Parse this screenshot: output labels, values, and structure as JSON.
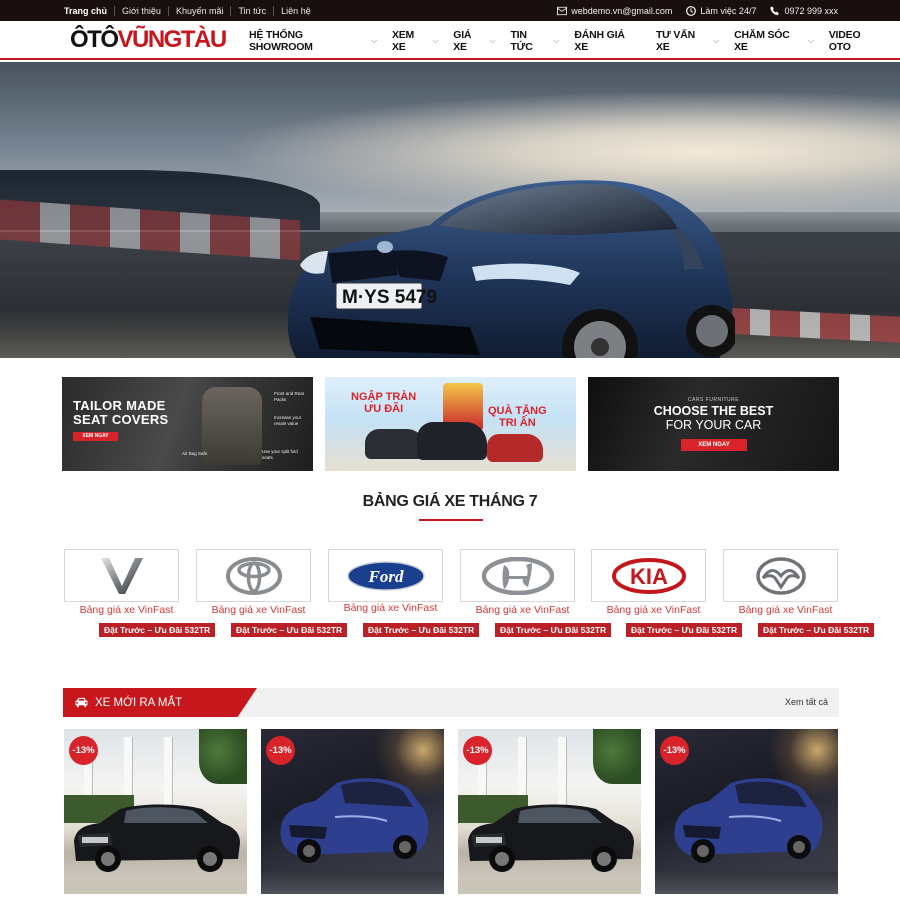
{
  "topbar": {
    "links": [
      "Trang chủ",
      "Giới thiệu",
      "Khuyến mãi",
      "Tin tức",
      "Liên hệ"
    ],
    "email": "webdemo.vn@gmail.com",
    "hours": "Làm việc 24/7",
    "phone": "0972 999 xxx"
  },
  "header": {
    "logo_part1": "ÔTÔ",
    "logo_part2": "VŨNGTÀU",
    "nav": [
      {
        "label": "HỆ THỐNG SHOWROOM",
        "dropdown": true
      },
      {
        "label": "XEM XE",
        "dropdown": true
      },
      {
        "label": "GIÁ XE",
        "dropdown": true
      },
      {
        "label": "TIN TỨC",
        "dropdown": true
      },
      {
        "label": "ĐÁNH GIÁ XE",
        "dropdown": false
      },
      {
        "label": "TƯ VẤN XE",
        "dropdown": true
      },
      {
        "label": "CHĂM SÓC XE",
        "dropdown": true
      },
      {
        "label": "VIDEO OTO",
        "dropdown": false
      }
    ]
  },
  "hero": {
    "plate": "M·YS 5479",
    "slides": 2,
    "active_slide": 1
  },
  "banners": {
    "b1": {
      "line1": "TAILOR MADE",
      "line2": "SEAT COVERS",
      "button": "XEM NGAY",
      "notes": [
        "Front and Rear Packs",
        "Increase your resale value",
        "Air Bag Safe",
        "Use your split fold seats"
      ]
    },
    "b2": {
      "line1": "NGẬP TRÀN",
      "line2": "ƯU ĐÃI",
      "line3": "QUÀ TẶNG",
      "line4": "TRI ÂN"
    },
    "b3": {
      "small": "CARS FURNITURE",
      "line1": "CHOOSE THE BEST",
      "line2": "FOR YOUR CAR",
      "button": "XEM NGAY"
    }
  },
  "price_section": {
    "title": "BẢNG GIÁ XE THÁNG 7",
    "brands": [
      {
        "logo": "vinfast-logo",
        "label": "Bảng giá xe VinFast",
        "tag": "Đặt Trước – Ưu Đãi 532TR"
      },
      {
        "logo": "toyota-logo",
        "label": "Bảng giá xe VinFast",
        "tag": "Đặt Trước – Ưu Đãi 532TR"
      },
      {
        "logo": "ford-logo",
        "label": "Bảng giá xe VinFast",
        "tag": "Đặt Trước – Ưu Đãi 532TR",
        "ford_text": "Ford"
      },
      {
        "logo": "hyundai-logo",
        "label": "Bảng giá xe VinFast",
        "tag": "Đặt Trước – Ưu Đãi 532TR"
      },
      {
        "logo": "kia-logo",
        "label": "Bảng giá xe VinFast",
        "tag": "Đặt Trước – Ưu Đãi 532TR",
        "kia_text": "KIA"
      },
      {
        "logo": "mazda-logo",
        "label": "Bảng giá xe VinFast",
        "tag": "Đặt Trước – Ưu Đãi 532TR"
      }
    ]
  },
  "new_cars": {
    "title": "XE MỚI RA MẮT",
    "see_all": "Xem tất cả",
    "cards": [
      {
        "discount": "-13%",
        "image": "black-suv"
      },
      {
        "discount": "-13%",
        "image": "blue-sedan"
      },
      {
        "discount": "-13%",
        "image": "black-suv"
      },
      {
        "discount": "-13%",
        "image": "blue-sedan"
      }
    ]
  },
  "colors": {
    "accent": "#c8161d",
    "topbar": "#1a0f0f",
    "tag": "#bb2027"
  }
}
